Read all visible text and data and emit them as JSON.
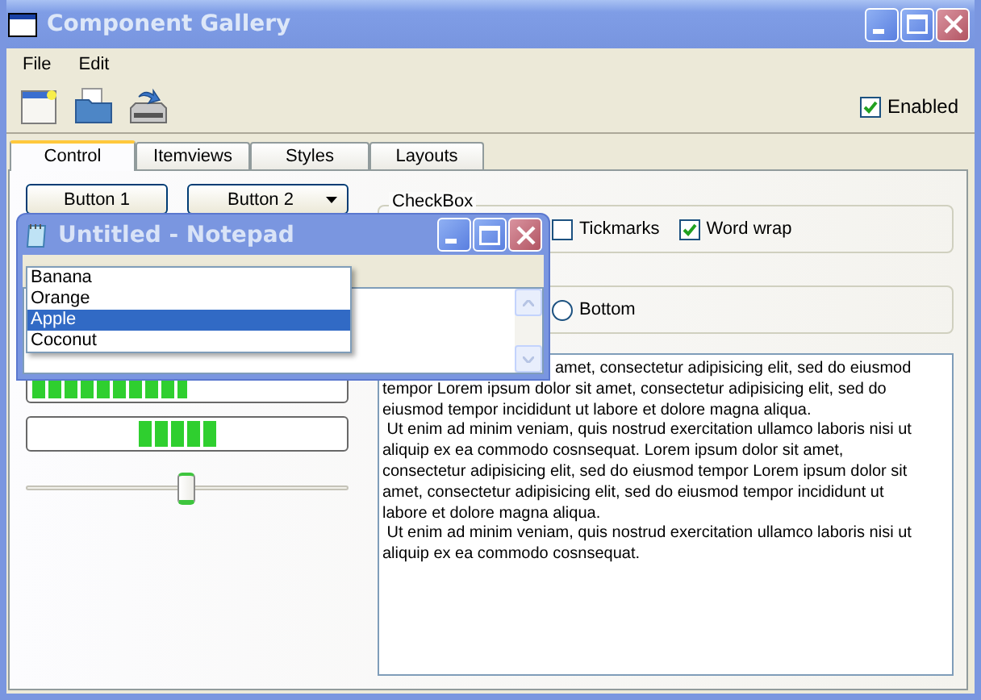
{
  "window": {
    "title": "Component Gallery"
  },
  "menu": [
    "File",
    "Edit"
  ],
  "toolbar": {
    "enabled": {
      "label": "Enabled",
      "checked": true
    }
  },
  "tabs": [
    {
      "label": "Control",
      "selected": true
    },
    {
      "label": "Itemviews",
      "selected": false
    },
    {
      "label": "Styles",
      "selected": false
    },
    {
      "label": "Layouts",
      "selected": false
    }
  ],
  "control_tab": {
    "buttons": [
      {
        "label": "Button 1",
        "kind": "push"
      },
      {
        "label": "Button 2",
        "kind": "menu"
      }
    ],
    "progress_bars": [
      {
        "kind": "determinate",
        "level": 0.5
      },
      {
        "kind": "busy"
      }
    ],
    "slider": {
      "level": 0.5
    },
    "checkbox_group": {
      "title": "CheckBox",
      "items": [
        {
          "label": "Tickmarks",
          "checked": false
        },
        {
          "label": "Word wrap",
          "checked": true
        }
      ]
    },
    "radio_group": {
      "items": [
        {
          "label": "Bottom",
          "selected": false
        }
      ]
    },
    "text_lines": [
      "amet, consectetur adipisicing elit, sed do eiusmod",
      "tempor Lorem ipsum dolor sit amet, consectetur adipisicing elit, sed do",
      "eiusmod tempor incididunt ut labore et dolore magna aliqua.",
      " Ut enim ad minim veniam, quis nostrud exercitation ullamco laboris nisi ut",
      "aliquip ex ea commodo cosnsequat. Lorem ipsum dolor sit amet,",
      "consectetur adipisicing elit, sed do eiusmod tempor Lorem ipsum dolor sit",
      "amet, consectetur adipisicing elit, sed do eiusmod tempor incididunt ut",
      "labore et dolore magna aliqua.",
      " Ut enim ad minim veniam, quis nostrud exercitation ullamco laboris nisi ut",
      "aliquip ex ea commodo cosnsequat."
    ]
  },
  "notepad": {
    "title": "Untitled - Notepad"
  },
  "dropdown_list": {
    "items": [
      {
        "label": "Banana",
        "selected": false
      },
      {
        "label": "Orange",
        "selected": false
      },
      {
        "label": "Apple",
        "selected": true
      },
      {
        "label": "Coconut",
        "selected": false
      }
    ]
  }
}
